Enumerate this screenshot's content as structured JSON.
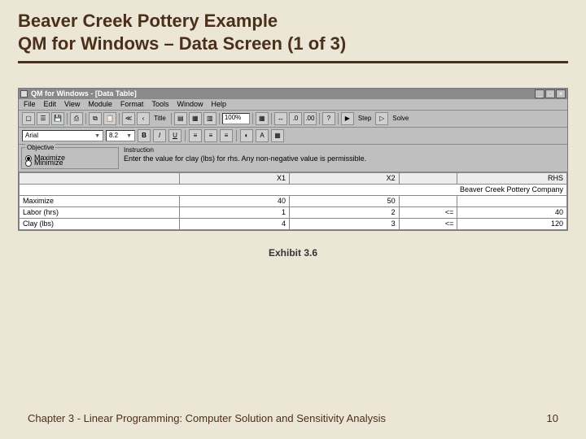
{
  "slide": {
    "title_line1": "Beaver Creek Pottery Example",
    "title_line2": "QM for Windows – Data Screen (1 of 3)",
    "exhibit": "Exhibit 3.6",
    "footer_left": "Chapter 3 - Linear Programming:  Computer Solution and Sensitivity Analysis",
    "footer_right": "10"
  },
  "window": {
    "title": "QM for Windows - [Data Table]",
    "menus": [
      "File",
      "Edit",
      "View",
      "Module",
      "Format",
      "Tools",
      "Window",
      "Help"
    ],
    "zoom": "100%",
    "action_step": "Step",
    "action_solve": "Solve",
    "font_name": "Arial",
    "font_size": "8.2"
  },
  "objective": {
    "group": "Objective",
    "opt_max": "Maximize",
    "opt_min": "Minimize",
    "selected": "Maximize"
  },
  "instruction": {
    "group": "Instruction",
    "text": "Enter the value for clay (lbs) for rhs. Any non-negative value is permissible."
  },
  "sheet": {
    "company": "Beaver Creek Pottery Company",
    "cols": [
      "",
      "X1",
      "X2",
      "",
      "RHS"
    ],
    "rows": [
      {
        "label": "Maximize",
        "x1": "40",
        "x2": "50",
        "rel": "",
        "rhs": ""
      },
      {
        "label": "Labor (hrs)",
        "x1": "1",
        "x2": "2",
        "rel": "<=",
        "rhs": "40"
      },
      {
        "label": "Clay (lbs)",
        "x1": "4",
        "x2": "3",
        "rel": "<=",
        "rhs": "120"
      }
    ]
  }
}
